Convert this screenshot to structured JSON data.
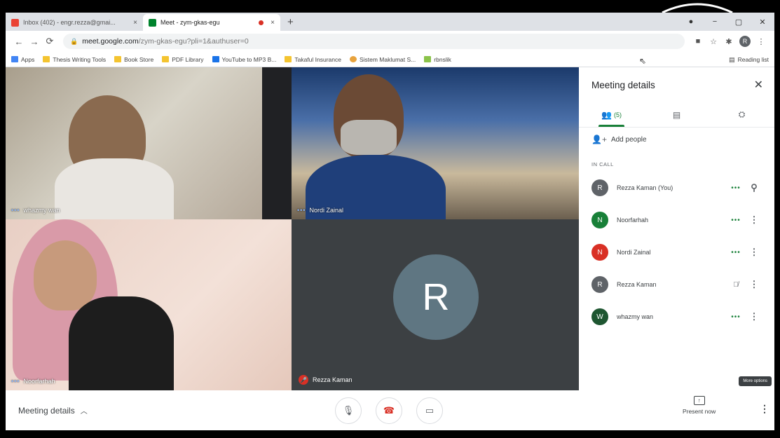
{
  "browser": {
    "tabs": [
      {
        "title": "Inbox (402) - engr.rezza@gmai...",
        "active": false
      },
      {
        "title": "Meet - zym-gkas-egu",
        "active": true
      },
      {
        "title": "",
        "active": false
      }
    ],
    "tab_close": "×",
    "new_tab": "+",
    "window_controls": [
      "●",
      "−",
      "▢",
      "✕"
    ],
    "url_host": "meet.google.com",
    "url_path": "/zym-gkas-egu?pli=1&authuser=0",
    "profile_initial": "R",
    "bookmarks": [
      {
        "label": "Apps",
        "kind": "apps"
      },
      {
        "label": "Thesis Writing Tools",
        "kind": "folder"
      },
      {
        "label": "Book Store",
        "kind": "folder"
      },
      {
        "label": "PDF Library",
        "kind": "folder"
      },
      {
        "label": "YouTube to MP3 B...",
        "kind": "site"
      },
      {
        "label": "Takaful Insurance",
        "kind": "folder"
      },
      {
        "label": "Sistem Maklumat S...",
        "kind": "site"
      },
      {
        "label": "rbnslik",
        "kind": "site"
      }
    ],
    "reading_list": "Reading list"
  },
  "meet": {
    "tiles": [
      {
        "name": "whazmy wan"
      },
      {
        "name": "Nordi Zainal"
      },
      {
        "name": "Noorfarhah"
      },
      {
        "name": "Rezza Kaman",
        "avatar_initial": "R"
      }
    ],
    "panel": {
      "title": "Meeting details",
      "people_count": "(5)",
      "add_people": "Add people",
      "in_call_label": "IN CALL",
      "participants": [
        {
          "name": "Rezza Kaman (You)",
          "initial": "R",
          "color": "#5f6368",
          "state": "speaking",
          "action": "pin"
        },
        {
          "name": "Noorfarhah",
          "initial": "N",
          "color": "#188038",
          "state": "speaking",
          "action": "more"
        },
        {
          "name": "Nordi Zainal",
          "initial": "N",
          "color": "#d93025",
          "state": "speaking",
          "action": "more"
        },
        {
          "name": "Rezza Kaman",
          "initial": "R",
          "color": "#5f6368",
          "state": "muted",
          "action": "more"
        },
        {
          "name": "whazmy wan",
          "initial": "W",
          "color": "#1e5631",
          "state": "speaking",
          "action": "more"
        }
      ],
      "tooltip": "More options"
    },
    "bottom": {
      "meeting_details": "Meeting details",
      "present_now": "Present now"
    }
  },
  "colors": {
    "accent_green": "#188038",
    "end_call_red": "#d93025",
    "stage_bg": "#202124"
  }
}
